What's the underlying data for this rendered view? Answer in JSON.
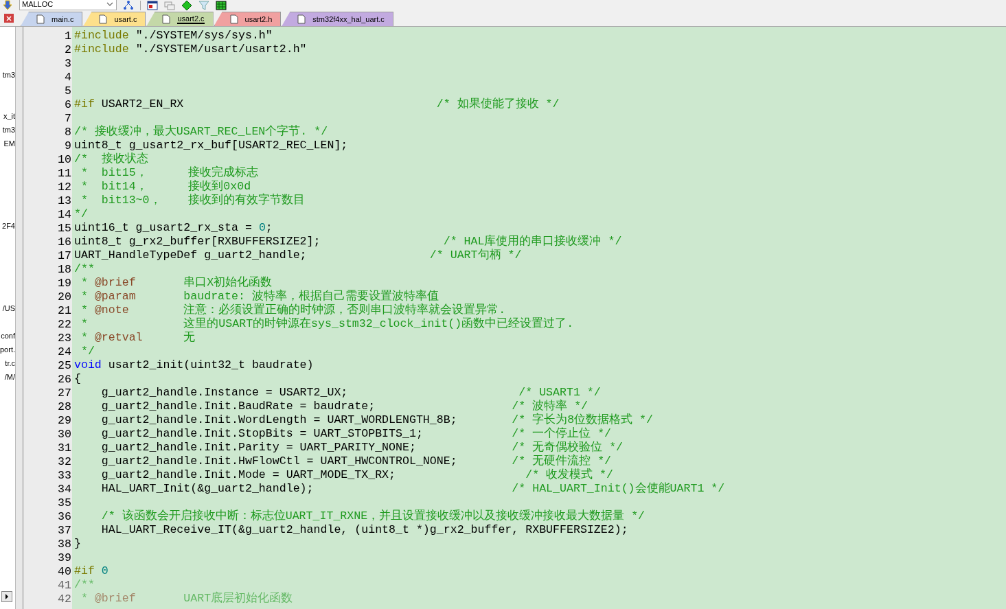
{
  "toolbar": {
    "target": "MALLOC"
  },
  "project_tree": [
    "tm3",
    "x_it",
    "tm3",
    "EM",
    "2F4",
    "/US",
    "conf",
    "port.",
    "tr.c",
    "/M/"
  ],
  "tabs": [
    {
      "label": "main.c",
      "selected": false,
      "color": "#c6d4ee"
    },
    {
      "label": "usart.c",
      "selected": false,
      "color": "#fde08c"
    },
    {
      "label": "usart2.c",
      "selected": true,
      "color": "#c4d8a8"
    },
    {
      "label": "usart2.h",
      "selected": false,
      "color": "#f0a0a0"
    },
    {
      "label": "stm32f4xx_hal_uart.c",
      "selected": false,
      "color": "#c2aae0"
    }
  ],
  "lines": [
    {
      "n": "1",
      "segs": [
        {
          "kind": "pp",
          "text": "#include"
        },
        {
          "kind": "text",
          "text": " \"./SYSTEM/sys/sys.h\""
        }
      ]
    },
    {
      "n": "2",
      "segs": [
        {
          "kind": "pp",
          "text": "#include"
        },
        {
          "kind": "text",
          "text": " \"./SYSTEM/usart/usart2.h\""
        }
      ]
    },
    {
      "n": "3"
    },
    {
      "n": "4"
    },
    {
      "n": "5"
    },
    {
      "n": "6",
      "segs": [
        {
          "kind": "pp",
          "text": "#if"
        },
        {
          "kind": "text",
          "text": " USART2_EN_RX                                     "
        },
        {
          "kind": "comment",
          "text": "/* 如果使能了接收 */"
        }
      ]
    },
    {
      "n": "7"
    },
    {
      "n": "8",
      "segs": [
        {
          "kind": "comment",
          "text": "/* 接收缓冲，最大USART_REC_LEN个字节. */"
        }
      ]
    },
    {
      "n": "9",
      "segs": [
        {
          "kind": "text",
          "text": "uint8_t g_usart2_rx_buf[USART2_REC_LEN];"
        }
      ]
    },
    {
      "n": "10",
      "segs": [
        {
          "kind": "comment",
          "text": "/*  接收状态"
        }
      ]
    },
    {
      "n": "11",
      "segs": [
        {
          "kind": "comment",
          "text": " *  bit15，      接收完成标志"
        }
      ]
    },
    {
      "n": "12",
      "segs": [
        {
          "kind": "comment",
          "text": " *  bit14，      接收到0x0d"
        }
      ]
    },
    {
      "n": "13",
      "segs": [
        {
          "kind": "comment",
          "text": " *  bit13~0，    接收到的有效字节数目"
        }
      ]
    },
    {
      "n": "14",
      "segs": [
        {
          "kind": "comment",
          "text": "*/"
        }
      ]
    },
    {
      "n": "15",
      "segs": [
        {
          "kind": "text",
          "text": "uint16_t g_usart2_rx_sta = "
        },
        {
          "kind": "number",
          "text": "0"
        },
        {
          "kind": "text",
          "text": ";"
        }
      ]
    },
    {
      "n": "16",
      "segs": [
        {
          "kind": "text",
          "text": "uint8_t g_rx2_buffer[RXBUFFERSIZE2];                  "
        },
        {
          "kind": "comment",
          "text": "/* HAL库使用的串口接收缓冲 */"
        }
      ]
    },
    {
      "n": "17",
      "segs": [
        {
          "kind": "text",
          "text": "UART_HandleTypeDef g_uart2_handle;                  "
        },
        {
          "kind": "comment",
          "text": "/* UART句柄 */"
        }
      ]
    },
    {
      "n": "18",
      "segs": [
        {
          "kind": "comment",
          "text": "/**"
        }
      ]
    },
    {
      "n": "19",
      "segs": [
        {
          "kind": "comment",
          "text": " * "
        },
        {
          "kind": "tag",
          "text": "@brief"
        },
        {
          "kind": "comment",
          "text": "       串口X初始化函数"
        }
      ]
    },
    {
      "n": "20",
      "segs": [
        {
          "kind": "comment",
          "text": " * "
        },
        {
          "kind": "tag",
          "text": "@param"
        },
        {
          "kind": "comment",
          "text": "       baudrate: 波特率，根据自己需要设置波特率值"
        }
      ]
    },
    {
      "n": "21",
      "segs": [
        {
          "kind": "comment",
          "text": " * "
        },
        {
          "kind": "tag",
          "text": "@note"
        },
        {
          "kind": "comment",
          "text": "        注意：必须设置正确的时钟源，否则串口波特率就会设置异常."
        }
      ]
    },
    {
      "n": "22",
      "segs": [
        {
          "kind": "comment",
          "text": " *              这里的USART的时钟源在sys_stm32_clock_init()函数中已经设置过了."
        }
      ]
    },
    {
      "n": "23",
      "segs": [
        {
          "kind": "comment",
          "text": " * "
        },
        {
          "kind": "tag",
          "text": "@retval"
        },
        {
          "kind": "comment",
          "text": "      无"
        }
      ]
    },
    {
      "n": "24",
      "segs": [
        {
          "kind": "comment",
          "text": " */"
        }
      ]
    },
    {
      "n": "25",
      "segs": [
        {
          "kind": "keyword",
          "text": "void"
        },
        {
          "kind": "text",
          "text": " usart2_init(uint32_t baudrate)"
        }
      ]
    },
    {
      "n": "26",
      "segs": [
        {
          "kind": "text",
          "text": "{"
        }
      ]
    },
    {
      "n": "27",
      "segs": [
        {
          "kind": "text",
          "text": "    g_uart2_handle.Instance = USART2_UX;                         "
        },
        {
          "kind": "comment",
          "text": "/* USART1 */"
        }
      ]
    },
    {
      "n": "28",
      "segs": [
        {
          "kind": "text",
          "text": "    g_uart2_handle.Init.BaudRate = baudrate;                    "
        },
        {
          "kind": "comment",
          "text": "/* 波特率 */"
        }
      ]
    },
    {
      "n": "29",
      "segs": [
        {
          "kind": "text",
          "text": "    g_uart2_handle.Init.WordLength = UART_WORDLENGTH_8B;        "
        },
        {
          "kind": "comment",
          "text": "/* 字长为8位数据格式 */"
        }
      ]
    },
    {
      "n": "30",
      "segs": [
        {
          "kind": "text",
          "text": "    g_uart2_handle.Init.StopBits = UART_STOPBITS_1;             "
        },
        {
          "kind": "comment",
          "text": "/* 一个停止位 */"
        }
      ]
    },
    {
      "n": "31",
      "segs": [
        {
          "kind": "text",
          "text": "    g_uart2_handle.Init.Parity = UART_PARITY_NONE;              "
        },
        {
          "kind": "comment",
          "text": "/* 无奇偶校验位 */"
        }
      ]
    },
    {
      "n": "32",
      "segs": [
        {
          "kind": "text",
          "text": "    g_uart2_handle.Init.HwFlowCtl = UART_HWCONTROL_NONE;        "
        },
        {
          "kind": "comment",
          "text": "/* 无硬件流控 */"
        }
      ]
    },
    {
      "n": "33",
      "segs": [
        {
          "kind": "text",
          "text": "    g_uart2_handle.Init.Mode = UART_MODE_TX_RX;                   "
        },
        {
          "kind": "comment",
          "text": "/* 收发模式 */"
        }
      ]
    },
    {
      "n": "34",
      "segs": [
        {
          "kind": "text",
          "text": "    HAL_UART_Init(&g_uart2_handle);                             "
        },
        {
          "kind": "comment",
          "text": "/* HAL_UART_Init()会使能UART1 */"
        }
      ]
    },
    {
      "n": "35"
    },
    {
      "n": "36",
      "segs": [
        {
          "kind": "comment",
          "text": "    /* 该函数会开启接收中断：标志位UART_IT_RXNE，并且设置接收缓冲以及接收缓冲接收最大数据量 */"
        }
      ]
    },
    {
      "n": "37",
      "segs": [
        {
          "kind": "text",
          "text": "    HAL_UART_Receive_IT(&g_uart2_handle, (uint8_t *)g_rx2_buffer, RXBUFFERSIZE2);"
        }
      ]
    },
    {
      "n": "38",
      "segs": [
        {
          "kind": "text",
          "text": "}"
        }
      ]
    },
    {
      "n": "39"
    },
    {
      "n": "40",
      "segs": [
        {
          "kind": "pp",
          "text": "#if "
        },
        {
          "kind": "number",
          "text": "0"
        }
      ]
    },
    {
      "n": "41",
      "faded": true,
      "segs": [
        {
          "kind": "comment",
          "text": "/**"
        }
      ]
    },
    {
      "n": "42",
      "faded": true,
      "segs": [
        {
          "kind": "comment",
          "text": " * "
        },
        {
          "kind": "tag",
          "text": "@brief"
        },
        {
          "kind": "comment",
          "text": "       UART底层初始化函数"
        }
      ]
    }
  ]
}
